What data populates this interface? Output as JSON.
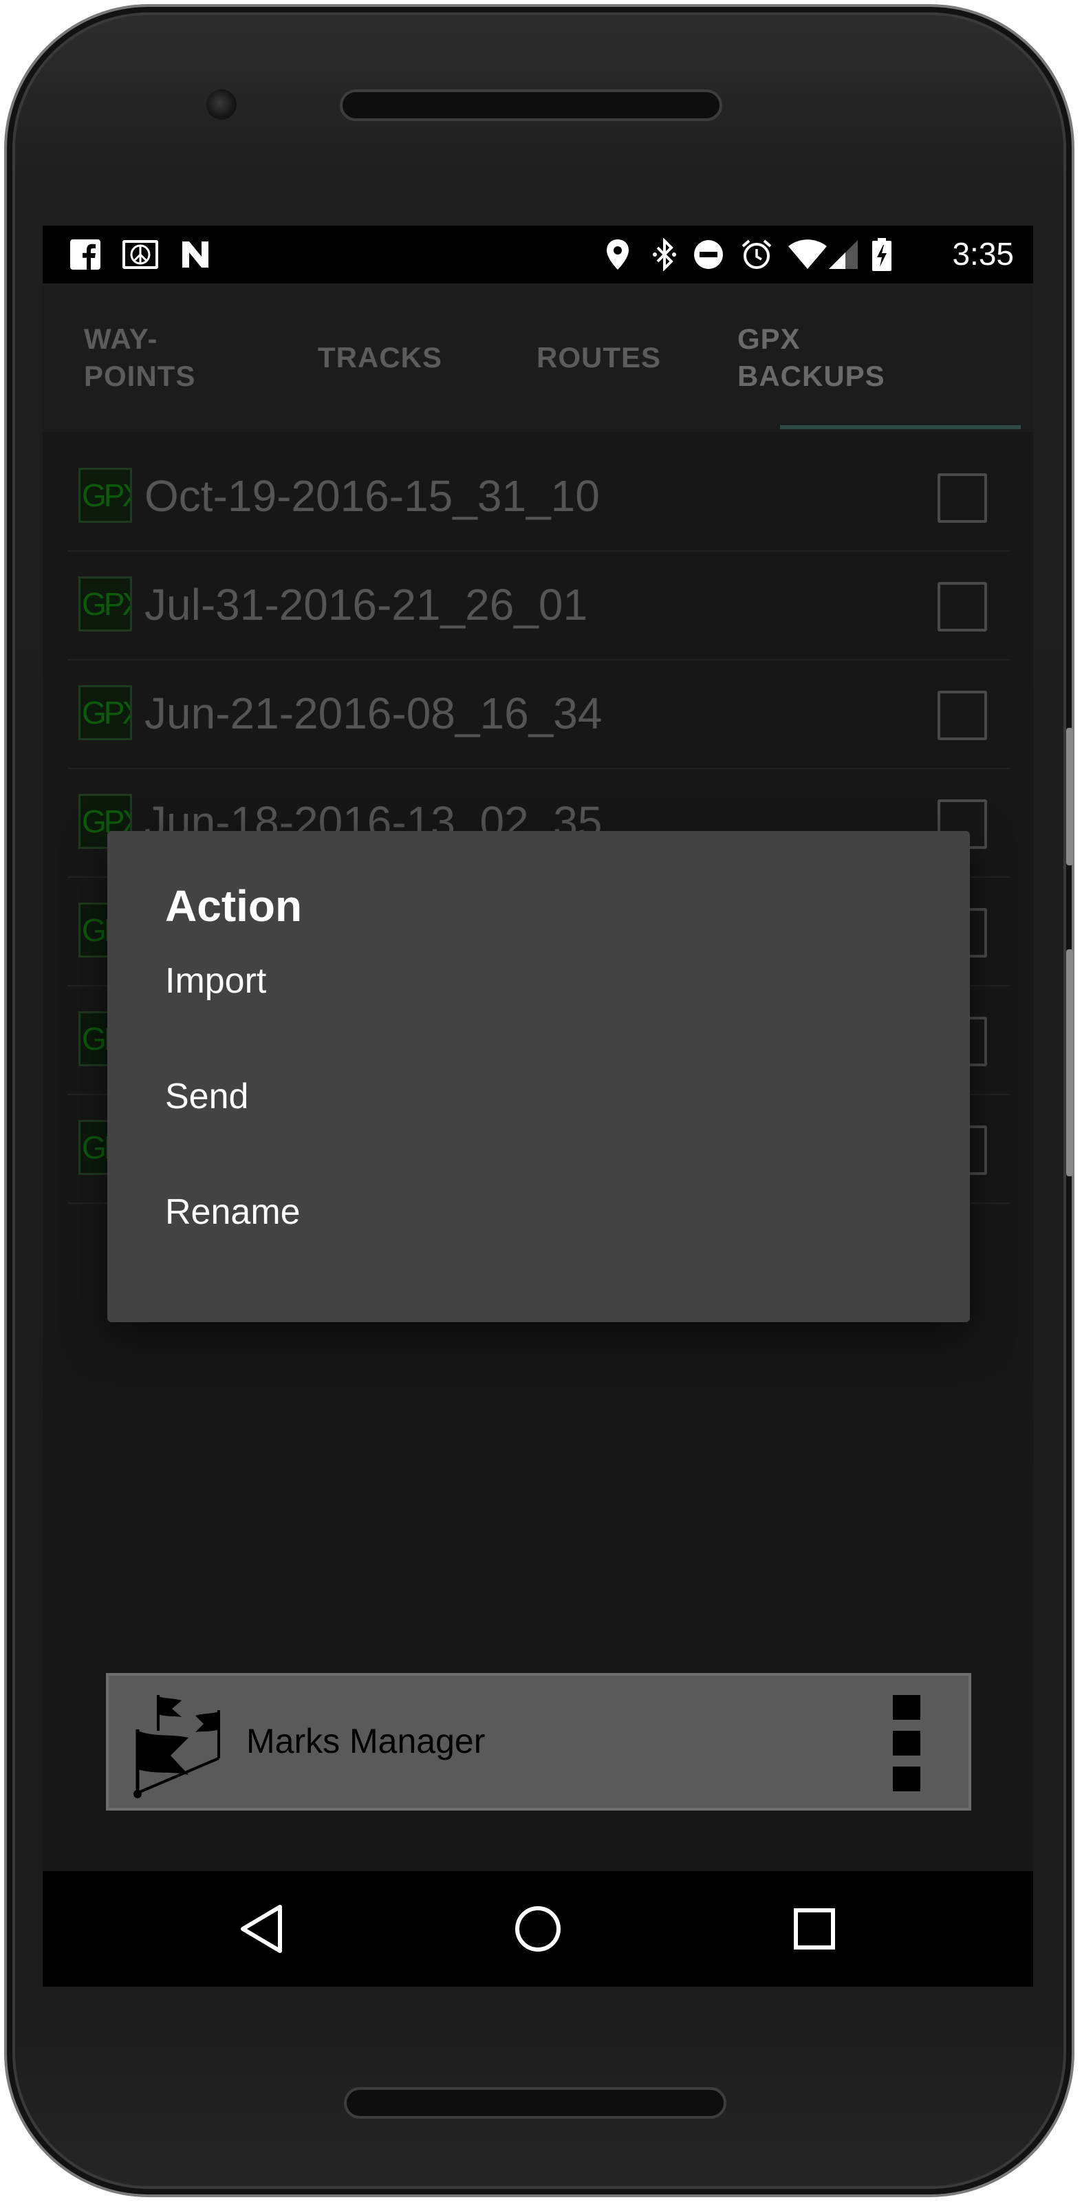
{
  "status_bar": {
    "left_icons": [
      "facebook-icon",
      "peace-icon",
      "n-app-icon"
    ],
    "right_icons": [
      "location-icon",
      "bluetooth-icon",
      "do-not-disturb-icon",
      "alarm-icon",
      "wifi-icon",
      "signal-icon",
      "battery-charging-icon"
    ],
    "time": "3:35"
  },
  "tabs": {
    "items": [
      {
        "label": "WAY-\nPOINTS",
        "selected": false
      },
      {
        "label": "TRACKS",
        "selected": false
      },
      {
        "label": "ROUTES",
        "selected": false
      },
      {
        "label": "GPX\nBACKUPS",
        "selected": true
      }
    ],
    "indicator_color": "#2d4a45"
  },
  "backups": {
    "icon_label": "GPX",
    "rows": [
      {
        "name": "Oct-19-2016-15_31_10",
        "checked": false
      },
      {
        "name": "Jul-31-2016-21_26_01",
        "checked": false
      },
      {
        "name": "Jun-21-2016-08_16_34",
        "checked": false
      },
      {
        "name": "Jun-18-2016-13_02_35",
        "checked": false
      },
      {
        "name": "",
        "checked": false
      },
      {
        "name": "",
        "checked": false
      },
      {
        "name": "",
        "checked": false
      }
    ]
  },
  "dialog": {
    "title": "Action",
    "items": [
      "Import",
      "Send",
      "Rename"
    ],
    "background": "#434343"
  },
  "bottom_panel": {
    "title": "Marks Manager",
    "logo_icon": "flags-icon",
    "menu_icon": "overflow-menu-icon"
  },
  "nav_bar": {
    "buttons": [
      "back-icon",
      "home-icon",
      "recents-icon"
    ]
  }
}
